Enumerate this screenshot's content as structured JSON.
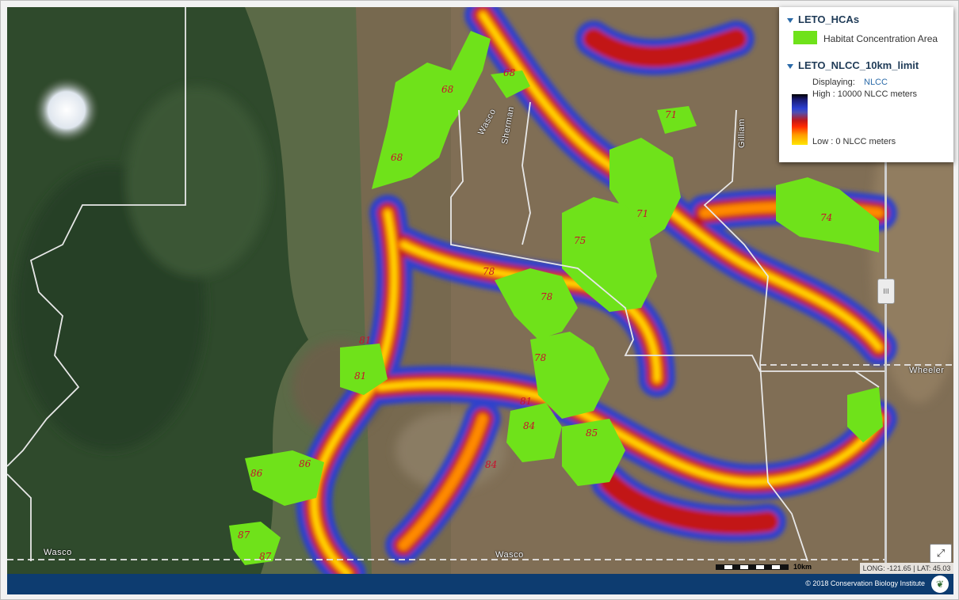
{
  "legend": {
    "layer1": {
      "title": "LETO_HCAs",
      "item": "Habitat Concentration Area",
      "color": "#6fe21a"
    },
    "layer2": {
      "title": "LETO_NLCC_10km_limit",
      "displaying_label": "Displaying:",
      "displaying_value": "NLCC",
      "high": "High : 10000 NLCC meters",
      "low": "Low : 0 NLCC meters"
    }
  },
  "places": {
    "wasco_rotated": "Wasco",
    "sherman": "Sherman",
    "gilliam": "Gilliam",
    "wheeler": "Wheeler",
    "wasco_left": "Wasco",
    "wasco_bottom": "Wasco"
  },
  "hca_labels": [
    "68",
    "68",
    "68",
    "71",
    "71",
    "74",
    "75",
    "78",
    "78",
    "78",
    "81",
    "81",
    "81",
    "84",
    "84",
    "85",
    "86",
    "86",
    "87",
    "87"
  ],
  "controls": {
    "slider_grip": "III",
    "expand_icon": "⤢"
  },
  "scale": {
    "label": "10km"
  },
  "coords": {
    "text": "LONG: -121.65 | LAT: 45.03"
  },
  "footer": {
    "copyright": "© 2018 Conservation Biology Institute",
    "logo_glyph": "❦"
  },
  "colors": {
    "footer": "#0d3c70",
    "hca": "#6fe21a",
    "corridor_hot": "#ff2a00",
    "corridor_warm": "#ffd200",
    "corridor_cool": "#2b3fd1"
  }
}
